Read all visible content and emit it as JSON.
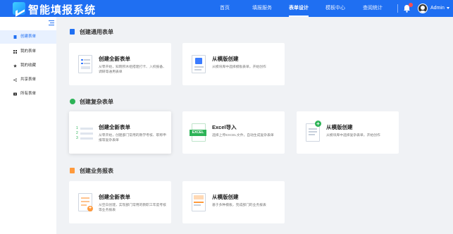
{
  "app": {
    "brand": "智能填报系统"
  },
  "header": {
    "nav": [
      {
        "label": "首页"
      },
      {
        "label": "填报服务"
      },
      {
        "label": "表单设计"
      },
      {
        "label": "模板中心"
      },
      {
        "label": "查阅统计"
      }
    ],
    "active_nav": "表单设计",
    "user": "Admin"
  },
  "sidebar": {
    "items": [
      {
        "label": "创建表单",
        "icon": "doc-icon"
      },
      {
        "label": "我的表单",
        "icon": "grid-icon"
      },
      {
        "label": "我的收藏",
        "icon": "star-icon"
      },
      {
        "label": "共享表单",
        "icon": "share-icon"
      },
      {
        "label": "所有表单",
        "icon": "video-icon"
      }
    ],
    "active": "创建表单"
  },
  "sections": [
    {
      "title": "创建通用表单",
      "cards": [
        {
          "title": "创建全新表单",
          "desc": "从零开始，知晓积木组搭建打卡、入校报备、调研等通用表单"
        },
        {
          "title": "从模版创建",
          "desc": "从模块库中选择模板表单，开始创作"
        }
      ]
    },
    {
      "title": "创建复杂表单",
      "cards": [
        {
          "title": "创建全新表单",
          "desc": "从零开始，创建部门常用的教学考核、职称申报等复杂表单"
        },
        {
          "title": "Excel导入",
          "desc": "选择上传EXCEL文件，自动生成复杂表单"
        },
        {
          "title": "从模版创建",
          "desc": "从模块库中选择复杂表单，开始创作"
        }
      ]
    },
    {
      "title": "创建业务报表",
      "cards": [
        {
          "title": "创建全新表单",
          "desc": "从空白创建，实现部门常用的教职工年度考核等业务报表"
        },
        {
          "title": "从模版创建",
          "desc": "基于多种模板，完成部门的业务报表"
        }
      ]
    }
  ],
  "illustration": {
    "excel_label": "EXCEL"
  },
  "colors": {
    "primary": "#1f6ff2",
    "green": "#2db357",
    "orange": "#ff9a3c",
    "badge": "#ff4d4f"
  }
}
